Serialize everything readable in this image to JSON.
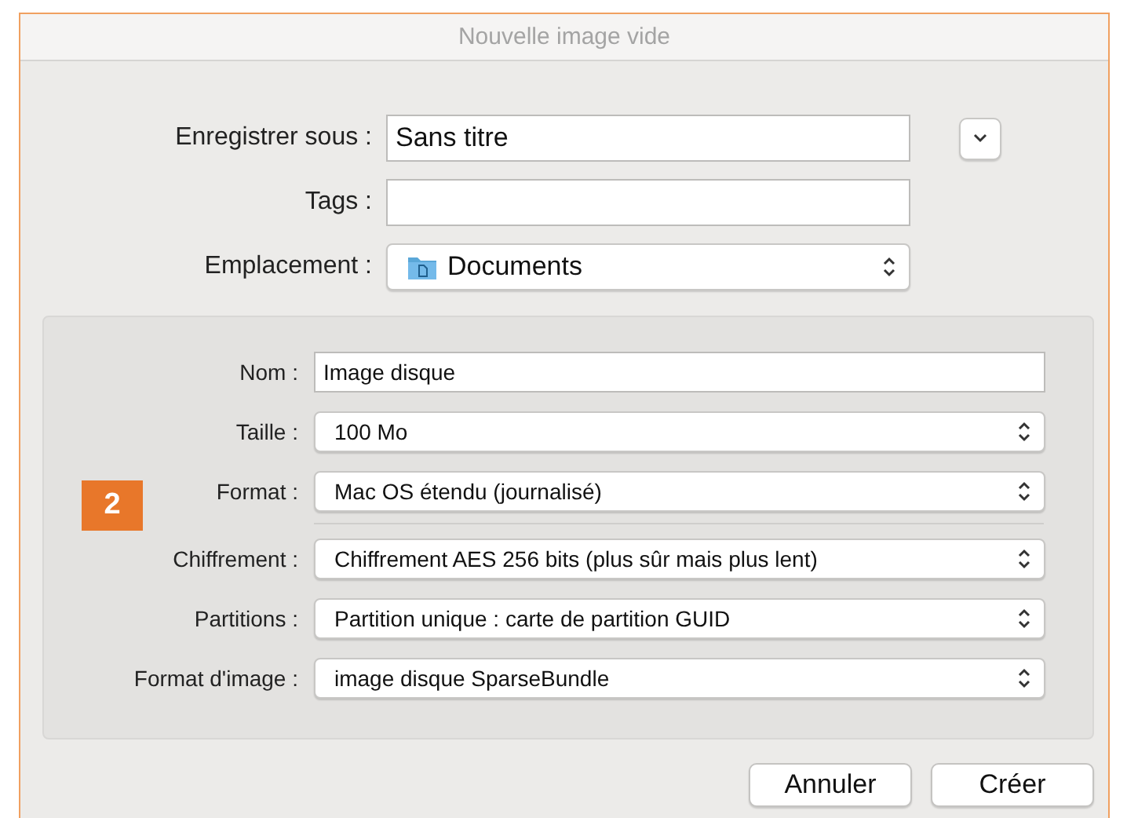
{
  "window": {
    "title": "Nouvelle image vide"
  },
  "top_fields": [
    {
      "kind": "text",
      "label": "Enregistrer sous :",
      "value": "Sans titre"
    },
    {
      "kind": "text",
      "label": "Tags :"
    },
    {
      "kind": "folder-popup",
      "label": "Emplacement :",
      "value": "Documents"
    }
  ],
  "callout": "2",
  "panel_sections": [
    {
      "rows": [
        {
          "kind": "text",
          "label": "Nom :",
          "value": "Image disque"
        },
        {
          "kind": "popup",
          "label": "Taille :",
          "value": "100 Mo"
        },
        {
          "kind": "popup",
          "label": "Format :",
          "value": "Mac OS étendu (journalisé)"
        }
      ]
    },
    {
      "rows": [
        {
          "kind": "popup",
          "label": "Chiffrement :",
          "value": "Chiffrement AES 256 bits (plus sûr mais plus lent)"
        },
        {
          "kind": "popup",
          "label": "Partitions :",
          "value": "Partition unique : carte de partition GUID"
        },
        {
          "kind": "popup",
          "label": "Format d'image :",
          "value": "image disque SparseBundle"
        }
      ]
    }
  ],
  "buttons": [
    {
      "label": "Annuler"
    },
    {
      "label": "Créer"
    }
  ]
}
